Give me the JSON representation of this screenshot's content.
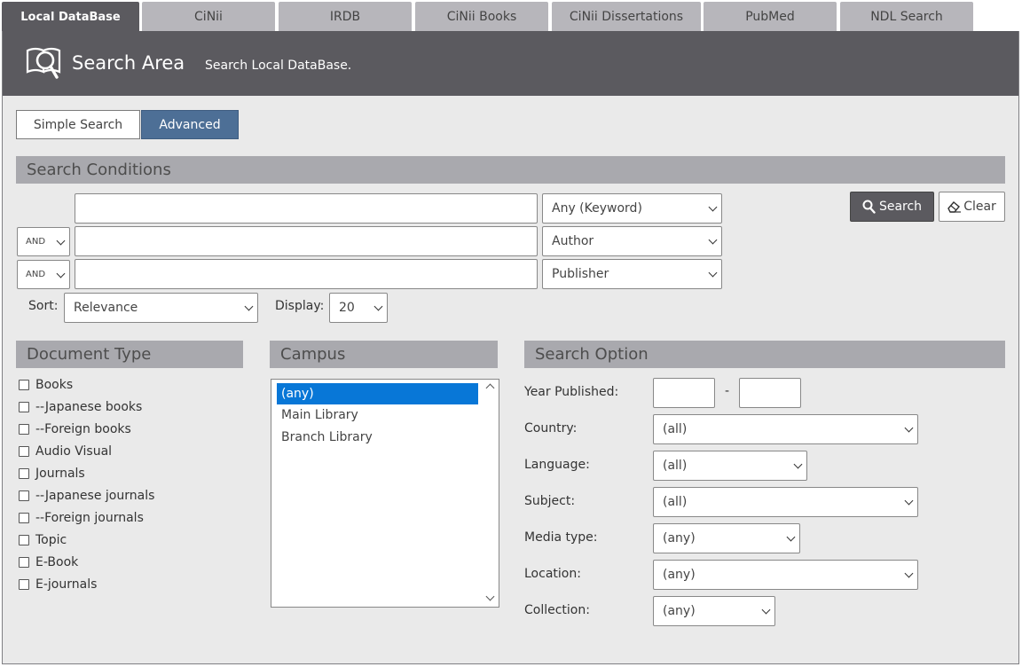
{
  "tabs": [
    {
      "label": "Local DataBase",
      "active": true
    },
    {
      "label": "CiNii",
      "active": false
    },
    {
      "label": "IRDB",
      "active": false
    },
    {
      "label": "CiNii Books",
      "active": false
    },
    {
      "label": "CiNii Dissertations",
      "active": false
    },
    {
      "label": "PubMed",
      "active": false
    },
    {
      "label": "NDL Search",
      "active": false
    }
  ],
  "header": {
    "title": "Search Area",
    "subtitle": "Search Local DataBase."
  },
  "mode": {
    "simple": "Simple Search",
    "advanced": "Advanced",
    "active": "Advanced"
  },
  "conditions": {
    "title": "Search Conditions",
    "rows": [
      {
        "operator": "",
        "value": "",
        "field": "Any (Keyword)"
      },
      {
        "operator": "AND",
        "value": "",
        "field": "Author"
      },
      {
        "operator": "AND",
        "value": "",
        "field": "Publisher"
      }
    ],
    "search_label": "Search",
    "clear_label": "Clear",
    "sort_label": "Sort:",
    "sort_value": "Relevance",
    "display_label": "Display:",
    "display_value": "20"
  },
  "document_type": {
    "title": "Document Type",
    "items": [
      "Books",
      "--Japanese books",
      "--Foreign books",
      "Audio Visual",
      "Journals",
      "--Japanese journals",
      "--Foreign journals",
      "Topic",
      "E-Book",
      "E-journals"
    ]
  },
  "campus": {
    "title": "Campus",
    "options": [
      "(any)",
      "Main Library",
      "Branch Library"
    ],
    "selected": "(any)"
  },
  "search_option": {
    "title": "Search Option",
    "year_label": "Year Published:",
    "year_from": "",
    "year_to": "",
    "year_sep": "-",
    "country_label": "Country:",
    "country_value": "(all)",
    "language_label": "Language:",
    "language_value": "(all)",
    "subject_label": "Subject:",
    "subject_value": "(all)",
    "media_label": "Media type:",
    "media_value": "(any)",
    "location_label": "Location:",
    "location_value": "(any)",
    "collection_label": "Collection:",
    "collection_value": "(any)"
  },
  "colors": {
    "tab_active": "#5b5a5f",
    "tab_inactive": "#b7b6bb",
    "accent": "#4d6f96",
    "selection": "#0877d7"
  }
}
